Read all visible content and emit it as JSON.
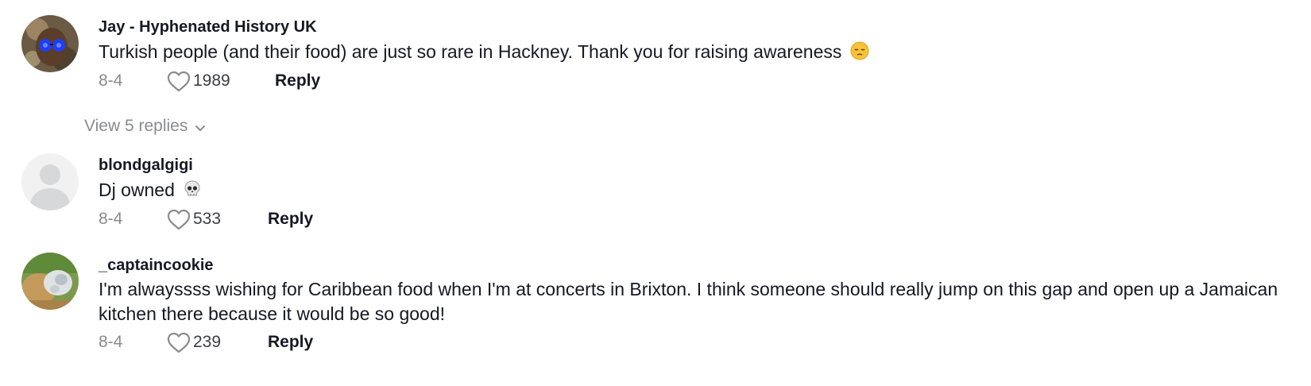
{
  "comments": [
    {
      "username": "Jay - Hyphenated History UK",
      "text": "Turkish people (and their food) are just so rare in Hackney. Thank you for raising awareness",
      "emoji": "pensive-face",
      "date": "8-4",
      "likes": "1989",
      "reply_label": "Reply",
      "avatar": "sunglasses-photo"
    },
    {
      "username": "blondgalgigi",
      "text": "Dj owned",
      "emoji": "skull",
      "date": "8-4",
      "likes": "533",
      "reply_label": "Reply",
      "avatar": "default-silhouette"
    },
    {
      "username": "_captaincookie",
      "text": "I'm alwayssss wishing for Caribbean food when I'm at concerts in Brixton. I think someone should really jump on this gap and open up a Jamaican kitchen there because it would be so good!",
      "date": "8-4",
      "likes": "239",
      "reply_label": "Reply",
      "avatar": "animal-photo"
    }
  ],
  "view_replies_label": "View 5 replies",
  "colors": {
    "text": "#161823",
    "muted": "#8a8b91",
    "background": "#ffffff"
  }
}
